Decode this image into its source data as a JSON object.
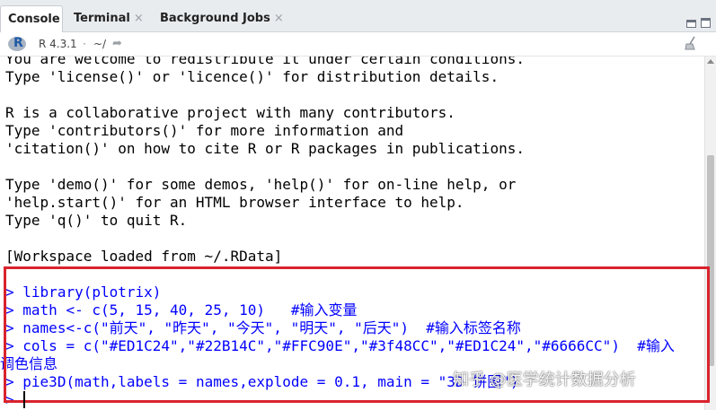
{
  "tabs": [
    {
      "label": "Console",
      "active": true
    },
    {
      "label": "Terminal",
      "close": "×"
    },
    {
      "label": "Background Jobs",
      "close": "×"
    }
  ],
  "toolbar": {
    "r_version": "R 4.3.1",
    "separator": "·",
    "working_dir": "~/",
    "icons": [
      "r-logo-icon",
      "go-to-directory-icon",
      "broom-clear-console-icon"
    ]
  },
  "console": {
    "lines": [
      "You are welcome to redistribute it under certain conditions.",
      "Type 'license()' or 'licence()' for distribution details.",
      "",
      "R is a collaborative project with many contributors.",
      "Type 'contributors()' for more information and",
      "'citation()' on how to cite R or R packages in publications.",
      "",
      "Type 'demo()' for some demos, 'help()' for on-line help, or",
      "'help.start()' for an HTML browser interface to help.",
      "Type 'q()' to quit R.",
      "",
      "[Workspace loaded from ~/.RData]"
    ],
    "prompt": ">",
    "commands": [
      "library(plotrix)",
      "math <- c(5, 15, 40, 25, 10)   #输入变量",
      "names<-c(\"前天\", \"昨天\", \"今天\", \"明天\", \"后天\")  #输入标签名称",
      "cols = c(\"#ED1C24\",\"#22B14C\",\"#FFC90E\",\"#3f48CC\",\"#ED1C24\",\"#6666CC\")  #输入",
      "调色信息",
      "pie3D(math,labels = names,explode = 0.1, main = \"3D 饼图\")"
    ]
  },
  "watermark": "知乎 @医学统计数据分析",
  "colors": {
    "highlight_border": "#d9232d",
    "command_text": "#0000ff",
    "tabbar_bg": "#e9ecef"
  }
}
